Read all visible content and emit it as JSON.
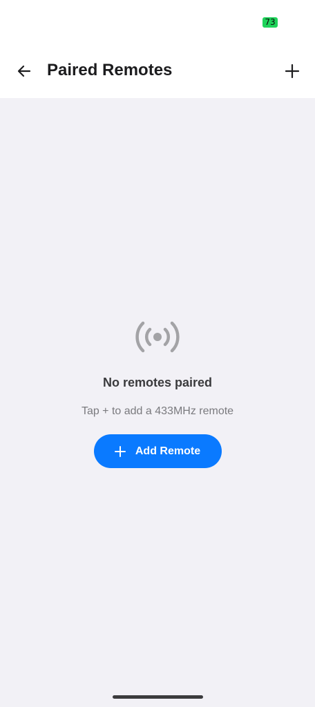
{
  "status_bar": {
    "battery_level": "73",
    "battery_color": "#1fd35a"
  },
  "app_bar": {
    "title": "Paired Remotes",
    "back_icon": "arrow-left-icon",
    "add_icon": "plus-icon"
  },
  "empty_state": {
    "icon": "broadcast-signal-icon",
    "title": "No remotes paired",
    "subtitle": "Tap + to add a 433MHz remote",
    "button_label": "Add Remote",
    "button_icon": "plus-icon"
  },
  "colors": {
    "accent": "#0a7aff",
    "background": "#f2f1f6",
    "header": "#ffffff",
    "icon_gray": "#a3a3a6"
  }
}
